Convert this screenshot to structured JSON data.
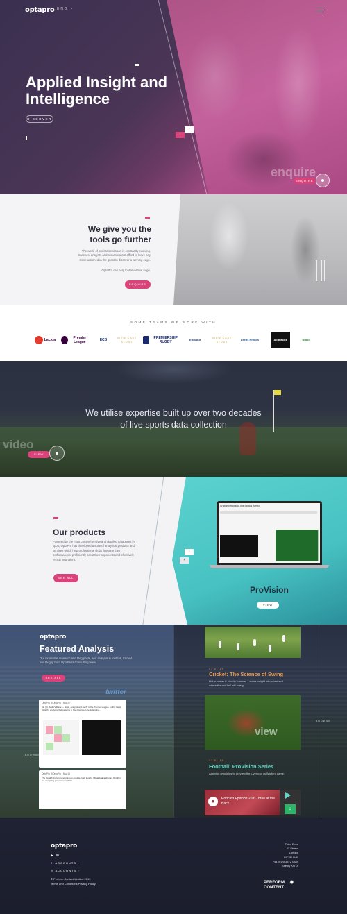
{
  "hero": {
    "logo": "optapro",
    "lang": "ENG ›",
    "title": "Applied Insight and Intelligence",
    "discover_label": "DISCOVER",
    "enquire_watermark": "enquire",
    "enquire_label": "ENQUIRE"
  },
  "tools": {
    "title": "We give you the tools go further",
    "para1": "The world of professional sport is constantly evolving. Coaches, analysts and scouts cannot afford to leave any stone unturned in the quest to discover a winning edge.",
    "para2": "OptaPro can help to deliver that edge.",
    "enquire_label": "ENQUIRE"
  },
  "teams": {
    "heading": "SOME TEAMS WE WORK WITH",
    "logos": [
      {
        "name": "LaLiga",
        "color": "#e33a2e"
      },
      {
        "name": "Premier League",
        "color": "#38003c"
      },
      {
        "name": "ECB",
        "color": "#1d3c7a"
      },
      {
        "name": "VIEW CASE STUDY",
        "color": "#c9a24a"
      },
      {
        "name": "PREMIERSHIP RUGBY",
        "color": "#1a2a6c"
      },
      {
        "name": "England",
        "color": "#1d3c7a"
      },
      {
        "name": "VIEW CASE STUDY",
        "color": "#c9a24a"
      },
      {
        "name": "Leeds Rhinos",
        "color": "#e0b83c"
      },
      {
        "name": "All Blacks",
        "color": "#111111"
      },
      {
        "name": "Brasil",
        "color": "#2f9a3e"
      }
    ]
  },
  "video": {
    "tagline": "We utilise expertise built up over two decades of live sports data collection",
    "watermark": "video",
    "view_label": "VIEW"
  },
  "products": {
    "title": "Our products",
    "description": "Powered by the most comprehensive and detailed databases in sport, OptaPro has developed a suite of analytical products and services which help professional clubs fine tune their performances, proficiently scout their opponents and effectively recruit new talent.",
    "see_all_label": "SEE ALL",
    "product_name": "ProVision",
    "view_label": "VIEW",
    "screen_title": "Cristiano Ronaldo dos Santos Aveiro"
  },
  "featured": {
    "logo": "optapro",
    "title": "Featured Analysis",
    "description": "Our innovative research and blog posts, and analysis in football, Cricket and Rugby from OptaPro's Consulting team.",
    "see_all_label": "SEE ALL",
    "twitter_watermark": "twitter",
    "tweet1_head": "OptaPro @OptaPro · Nov 20",
    "tweet1_text": "Mo (3), Sadio's Mane — Stats, analysis and verify in the Premier League. In this latest OptaPro analysis, find patterns in how Liverpool are defending...",
    "tweet2_head": "OptaPro @OptaPro · Nov 18",
    "tweet2_text": "The OptaProForum is returning to provide fresh insight. #DataAnalysisForum OptaPro are accepting proposals for 2019.",
    "browse_label": "BROWSE",
    "articles": [
      {
        "date": "07.01.19",
        "title": "Cricket: The Science of Swing",
        "desc": "Hot summer is cloudy summer – some insight into when and where the red ball will swing."
      },
      {
        "date": "12.01.19",
        "title": "Football: ProVision Series",
        "desc": "Applying principles to preview the Liverpool vs Watford game."
      }
    ],
    "view_watermark": "view",
    "podcast_title": "Podcast Episode 203: Three at the Back"
  },
  "footer": {
    "logo": "optapro",
    "accounts_label": "ACCOUNTS",
    "copyright": "© Perform Content Limited 2019",
    "links": "Terms and Conditions    Privacy Policy",
    "address": [
      "Third Floor",
      "11 Strand",
      "London",
      "WC2N 5HR",
      "+44 (0)20 3372 0834",
      "Site by KOTA"
    ],
    "perform": "PERFORM CONTENT"
  }
}
